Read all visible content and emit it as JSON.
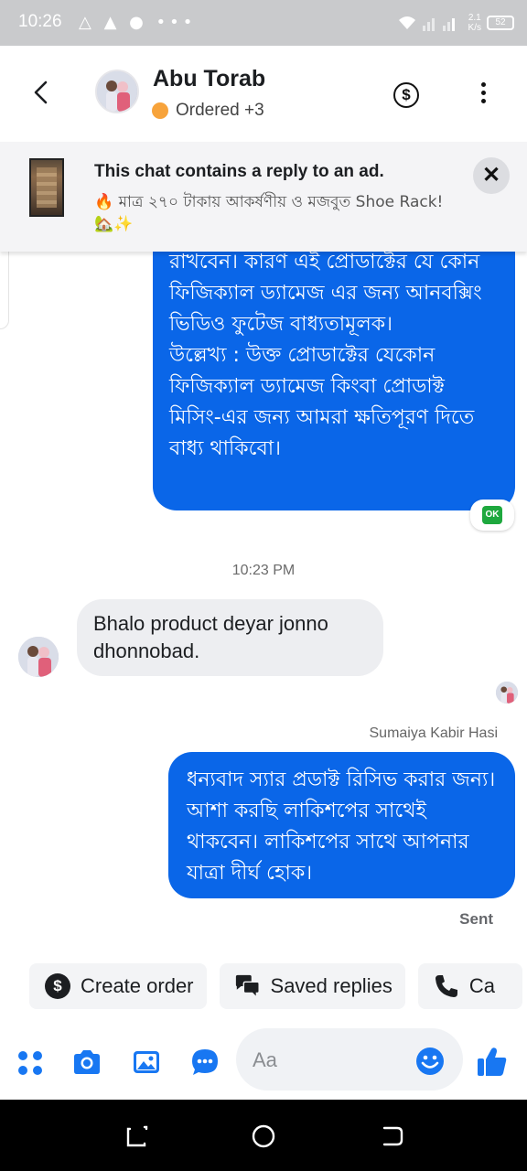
{
  "status_bar": {
    "time": "10:26",
    "icons_left": "△ ▲ ● •••",
    "speed": "2.1\nK/s",
    "speed_top": "2.1",
    "speed_bottom": "K/s",
    "battery": "52"
  },
  "header": {
    "contact_name": "Abu Torab",
    "status_text": "Ordered +3",
    "status_color": "#f7a33b"
  },
  "ad_banner": {
    "title": "This chat contains a reply to an ad.",
    "description": "🔥 মাত্র ২৭০ টাকায় আকর্ষণীয় ও মজবুত  Shoe Rack! 🏡✨"
  },
  "messages": {
    "outgoing_top": "রাখবেন। কারণ এই প্রোডাক্টের যে কোন ফিজিক্যাল ড্যামেজ এর জন্য আনবক্সিং ভিডিও ফুটেজ বাধ্যতামূলক।\nউল্লেখ্য : উক্ত প্রোডাক্টের যেকোন ফিজিক্যাল ড্যামেজ কিংবা প্রোডাক্ট মিসিং-এর জন্য আমরা ক্ষতিপূরণ দিতে বাধ্য থাকিবো।",
    "ok_badge": "OK",
    "time_separator": "10:23 PM",
    "incoming": "Bhalo product deyar jonno dhonnobad.",
    "sender_name": "Sumaiya Kabir Hasi",
    "outgoing_bottom": "ধন্যবাদ স্যার প্রডাক্ট রিসিভ করার জন্য। আশা করছি লাকিশপের সাথেই থাকবেন। লাকিশপের সাথে আপনার যাত্রা দীর্ঘ হোক।",
    "sent_label": "Sent"
  },
  "quick_replies": {
    "create_order": "Create order",
    "saved_replies": "Saved replies",
    "call": "Ca"
  },
  "composer": {
    "placeholder": "Aa"
  },
  "colors": {
    "accent": "#0a66e8",
    "icon_blue": "#1877f2",
    "bubble_in": "#edeef1"
  }
}
